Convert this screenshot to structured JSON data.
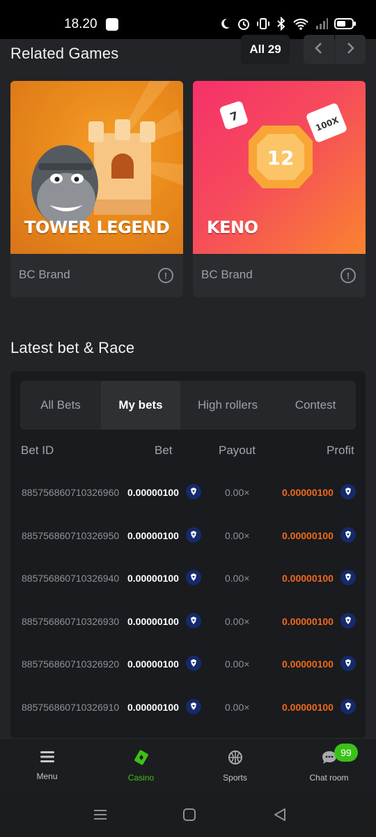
{
  "status_bar": {
    "time": "18.20",
    "icons": [
      "moon-icon",
      "alarm-icon",
      "vibrate-icon",
      "bluetooth-icon",
      "wifi-icon",
      "signal-icon",
      "battery-icon"
    ]
  },
  "related_games": {
    "title": "Related Games",
    "all_label": "All 29",
    "prev_icon": "chevron-left-icon",
    "next_icon": "chevron-right-icon",
    "games": [
      {
        "name": "TOWER LEGEND",
        "brand": "BC Brand",
        "info_icon": "info-icon"
      },
      {
        "name": "KENO",
        "brand": "BC Brand",
        "info_icon": "info-icon",
        "art_numbers": [
          "7",
          "12",
          "100X"
        ]
      }
    ]
  },
  "latest_bets": {
    "title": "Latest bet & Race",
    "tabs": [
      "All Bets",
      "My bets",
      "High rollers",
      "Contest"
    ],
    "active_tab": "My bets",
    "columns": [
      "Bet ID",
      "Bet",
      "Payout",
      "Profit"
    ],
    "rows": [
      {
        "id": "885756860710326960",
        "bet": "0.00000100",
        "payout": "0.00×",
        "profit": "0.00000100"
      },
      {
        "id": "885756860710326950",
        "bet": "0.00000100",
        "payout": "0.00×",
        "profit": "0.00000100"
      },
      {
        "id": "885756860710326940",
        "bet": "0.00000100",
        "payout": "0.00×",
        "profit": "0.00000100"
      },
      {
        "id": "885756860710326930",
        "bet": "0.00000100",
        "payout": "0.00×",
        "profit": "0.00000100"
      },
      {
        "id": "885756860710326920",
        "bet": "0.00000100",
        "payout": "0.00×",
        "profit": "0.00000100"
      },
      {
        "id": "885756860710326910",
        "bet": "0.00000100",
        "payout": "0.00×",
        "profit": "0.00000100"
      }
    ],
    "colors": {
      "profit": "#f06a1c",
      "coin": "#152a6b"
    }
  },
  "bottom_nav": {
    "items": [
      {
        "label": "Menu",
        "icon": "hamburger-icon"
      },
      {
        "label": "Casino",
        "icon": "casino-icon",
        "active": true
      },
      {
        "label": "Sports",
        "icon": "sports-ball-icon"
      },
      {
        "label": "Chat room",
        "icon": "chat-icon"
      }
    ],
    "chat_badge": "99",
    "active_color": "#3bc117"
  },
  "system_nav": [
    "recents-icon",
    "home-icon",
    "back-icon"
  ]
}
